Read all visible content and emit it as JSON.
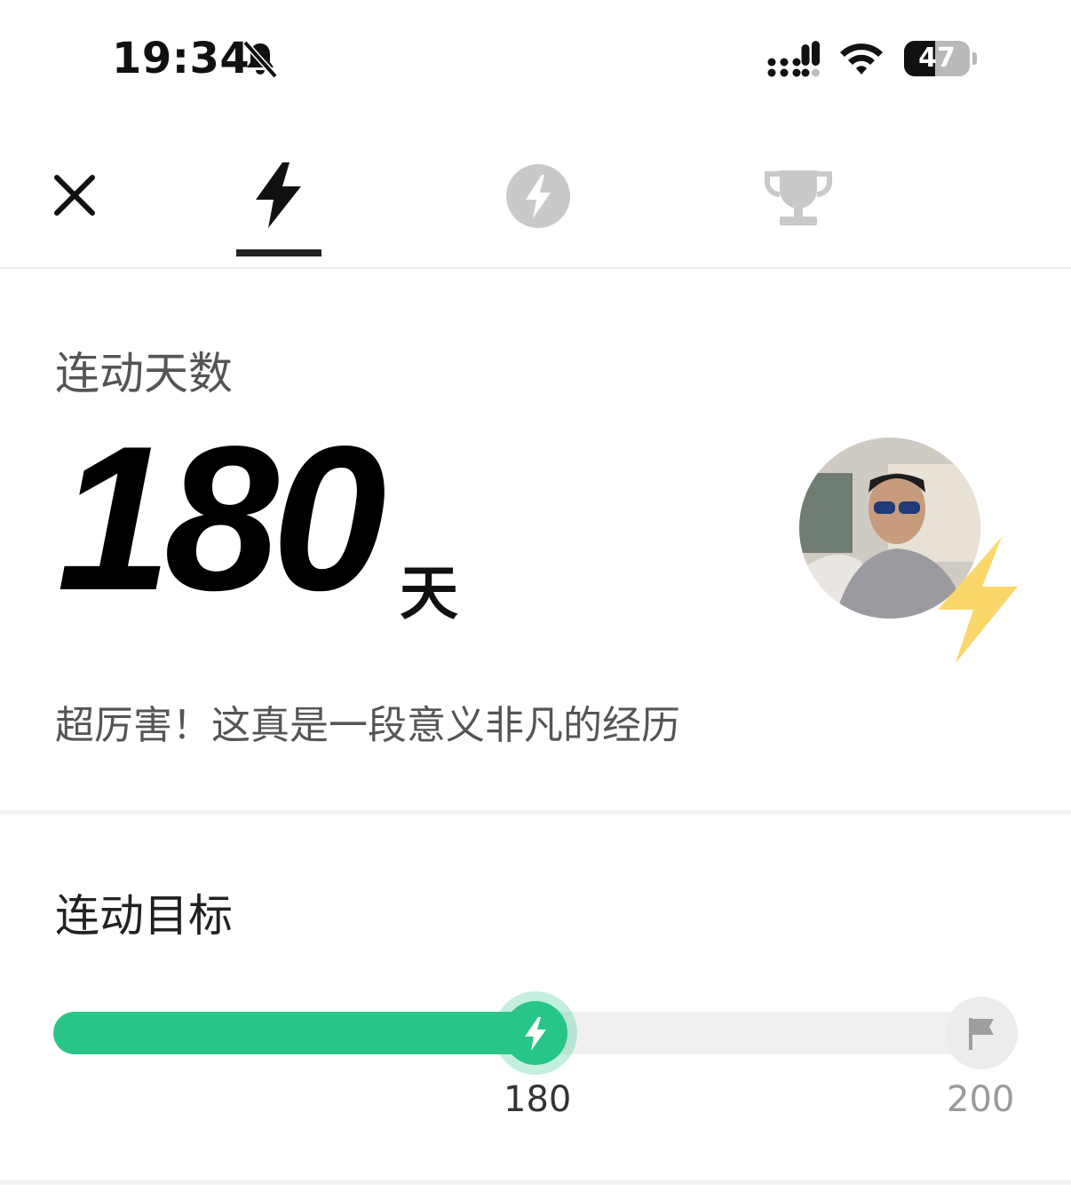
{
  "status_bar": {
    "time": "19:34",
    "battery_percent": "47",
    "battery_level": 0.47,
    "icons": [
      "bell-slash-icon",
      "cellular-signal-icon",
      "wifi-icon",
      "battery-icon"
    ]
  },
  "tabs": [
    {
      "icon": "lightning-bolt-icon",
      "active": true
    },
    {
      "icon": "energy-circle-icon",
      "active": false
    },
    {
      "icon": "trophy-icon",
      "active": false
    }
  ],
  "streak": {
    "label": "连动天数",
    "days": "180",
    "unit": "天",
    "message": "超厉害！这真是一段意义非凡的经历"
  },
  "goal": {
    "label": "连动目标",
    "current": "180",
    "target": "200",
    "progress": 0.5
  },
  "colors": {
    "accent_green": "#27c587",
    "bolt_yellow": "#f8d35a",
    "muted_text": "#555555",
    "inactive_icon": "#c8c8c8"
  }
}
